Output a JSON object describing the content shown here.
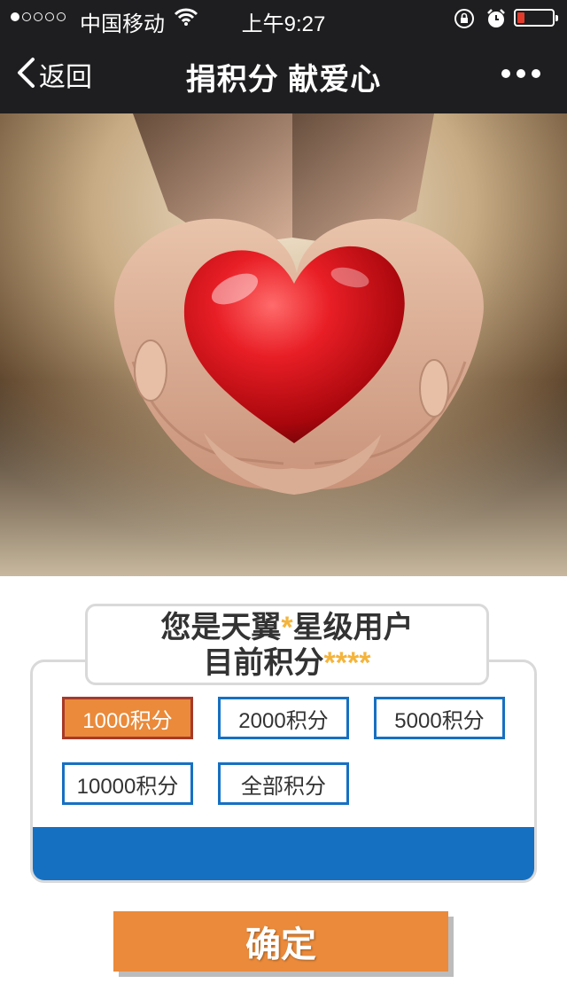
{
  "status_bar": {
    "carrier": "中国移动",
    "time": "上午9:27",
    "signal_strength": 1,
    "battery_level": 0.2,
    "icons": [
      "signal-icon",
      "wifi-icon",
      "rotation-lock-icon",
      "alarm-icon",
      "battery-icon"
    ]
  },
  "nav": {
    "back_label": "返回",
    "title": "捐积分 献爱心",
    "icons": [
      "chevron-left-icon",
      "more-icon"
    ]
  },
  "hero": {
    "image_name": "heart-in-hands-image"
  },
  "points_card": {
    "line1_prefix": "您是天翼",
    "line1_mask": "*",
    "line1_suffix": "星级用户",
    "line2_prefix": "目前积分",
    "line2_mask": "****",
    "options": [
      "1000积分",
      "2000积分",
      "5000积分",
      "10000积分",
      "全部积分"
    ],
    "selected_index": 0
  },
  "confirm_label": "确定",
  "colors": {
    "bar_bg": "#1e1e20",
    "accent_orange": "#ea8a3a",
    "selected_border": "#a63a2a",
    "option_border": "#1670c2",
    "star": "#f4b43c",
    "battery_low": "#e23b2c"
  }
}
